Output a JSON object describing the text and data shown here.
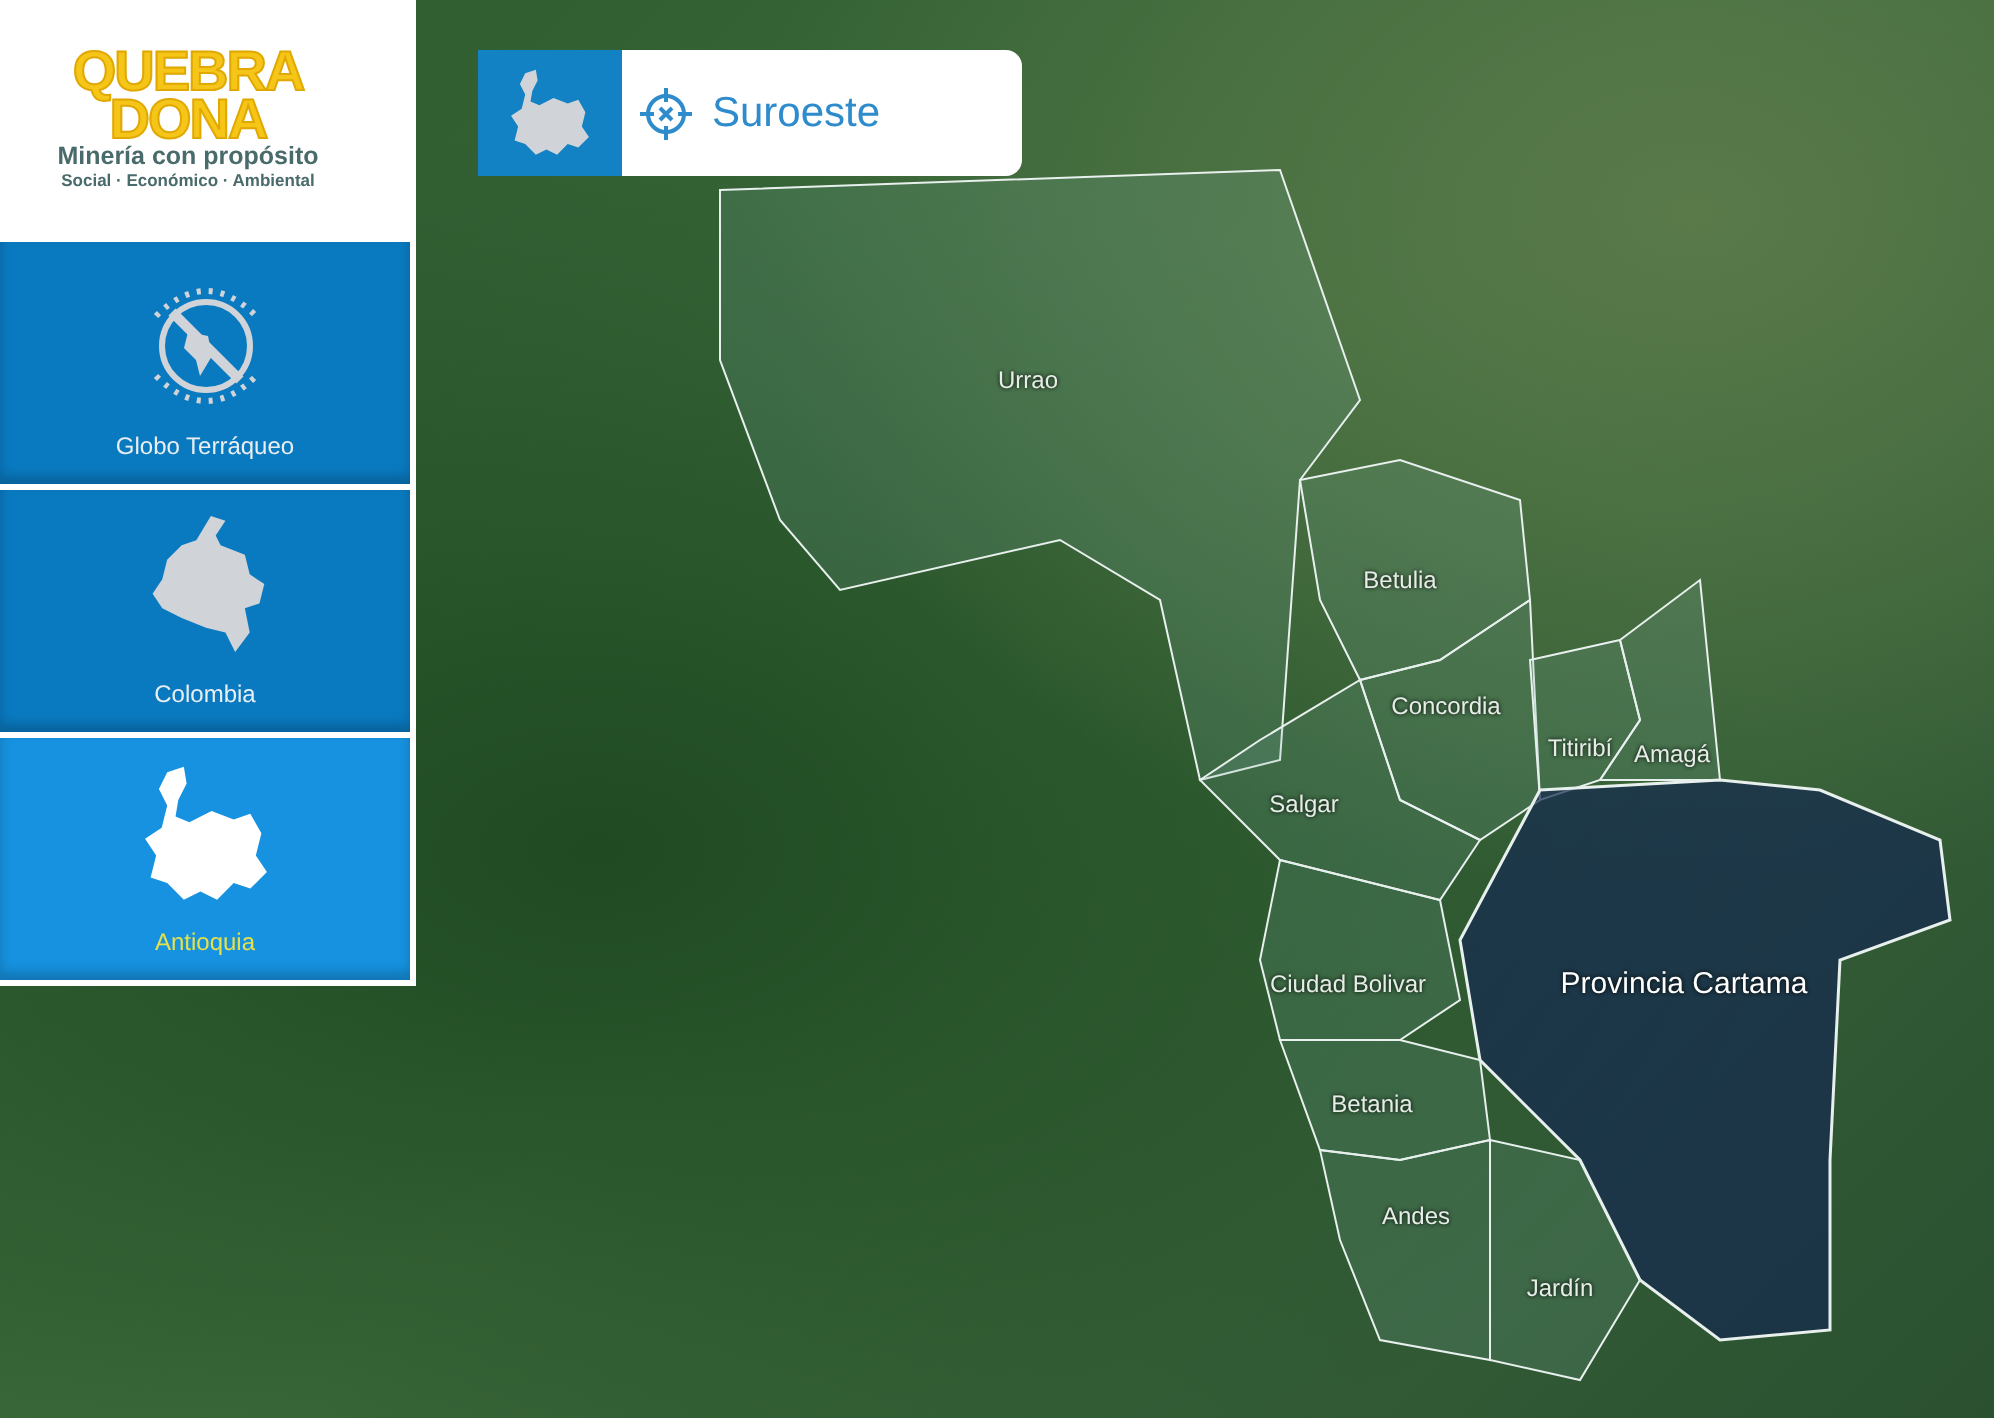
{
  "logo": {
    "title_line_1": "QUEBRA",
    "title_line_2": "DONA",
    "tagline": "Minería con propósito",
    "pillars": "Social · Económico · Ambiental"
  },
  "sidebar": {
    "items": [
      {
        "label": "Globo Terráqueo",
        "kind": "globe",
        "selected": false
      },
      {
        "label": "Colombia",
        "kind": "colombia",
        "selected": false
      },
      {
        "label": "Antioquia",
        "kind": "antioquia",
        "selected": true
      }
    ]
  },
  "breadcrumb": {
    "label": "Suroeste"
  },
  "map": {
    "regions": [
      {
        "label": "Urrao",
        "selected": false
      },
      {
        "label": "Betulia",
        "selected": false
      },
      {
        "label": "Concordia",
        "selected": false
      },
      {
        "label": "Titiribí",
        "selected": false
      },
      {
        "label": "Amagá",
        "selected": false
      },
      {
        "label": "Salgar",
        "selected": false
      },
      {
        "label": "Ciudad Bolivar",
        "selected": false
      },
      {
        "label": "Betania",
        "selected": false
      },
      {
        "label": "Andes",
        "selected": false
      },
      {
        "label": "Jardín",
        "selected": false
      },
      {
        "label": "Provincia Cartama",
        "selected": true
      }
    ]
  }
}
